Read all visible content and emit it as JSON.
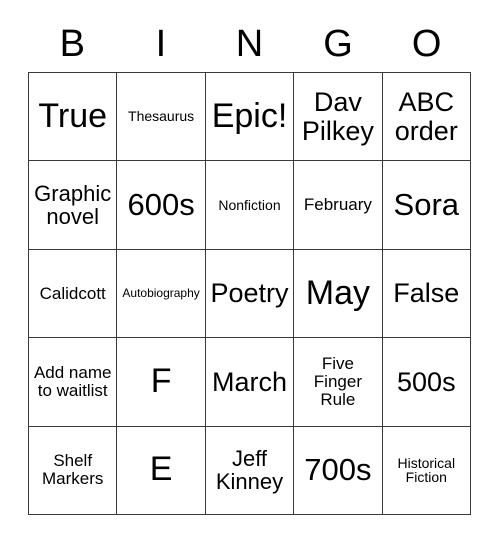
{
  "card": {
    "title": "Bingo Card",
    "background_color": "#ffffff",
    "border_color": "#3a3a3a",
    "text_color": "#000000"
  },
  "header": {
    "letters": [
      {
        "label": "B"
      },
      {
        "label": "I"
      },
      {
        "label": "N"
      },
      {
        "label": "G"
      },
      {
        "label": "O"
      }
    ]
  },
  "grid": {
    "rows": 5,
    "columns": 5,
    "cells": [
      {
        "text": "True",
        "size": "fs-xxl"
      },
      {
        "text": "Thesaurus",
        "size": "fs-xs"
      },
      {
        "text": "Epic!",
        "size": "fs-xxl"
      },
      {
        "text": "Dav Pilkey",
        "size": "fs-lg"
      },
      {
        "text": "ABC order",
        "size": "fs-lg"
      },
      {
        "text": "Graphic novel",
        "size": "fs-md"
      },
      {
        "text": "600s",
        "size": "fs-xl"
      },
      {
        "text": "Nonfiction",
        "size": "fs-xs"
      },
      {
        "text": "February",
        "size": "fs-sm"
      },
      {
        "text": "Sora",
        "size": "fs-xl"
      },
      {
        "text": "Calidcott",
        "size": "fs-sm"
      },
      {
        "text": "Autobiography",
        "size": "fs-xxs"
      },
      {
        "text": "Poetry",
        "size": "fs-lg"
      },
      {
        "text": "May",
        "size": "fs-xxl"
      },
      {
        "text": "False",
        "size": "fs-lg"
      },
      {
        "text": "Add name to waitlist",
        "size": "fs-sm"
      },
      {
        "text": "F",
        "size": "fs-xxl"
      },
      {
        "text": "March",
        "size": "fs-lg"
      },
      {
        "text": "Five Finger Rule",
        "size": "fs-sm"
      },
      {
        "text": "500s",
        "size": "fs-lg"
      },
      {
        "text": "Shelf Markers",
        "size": "fs-sm"
      },
      {
        "text": "E",
        "size": "fs-xxl"
      },
      {
        "text": "Jeff Kinney",
        "size": "fs-md"
      },
      {
        "text": "700s",
        "size": "fs-xl"
      },
      {
        "text": "Historical Fiction",
        "size": "fs-xs"
      }
    ]
  }
}
